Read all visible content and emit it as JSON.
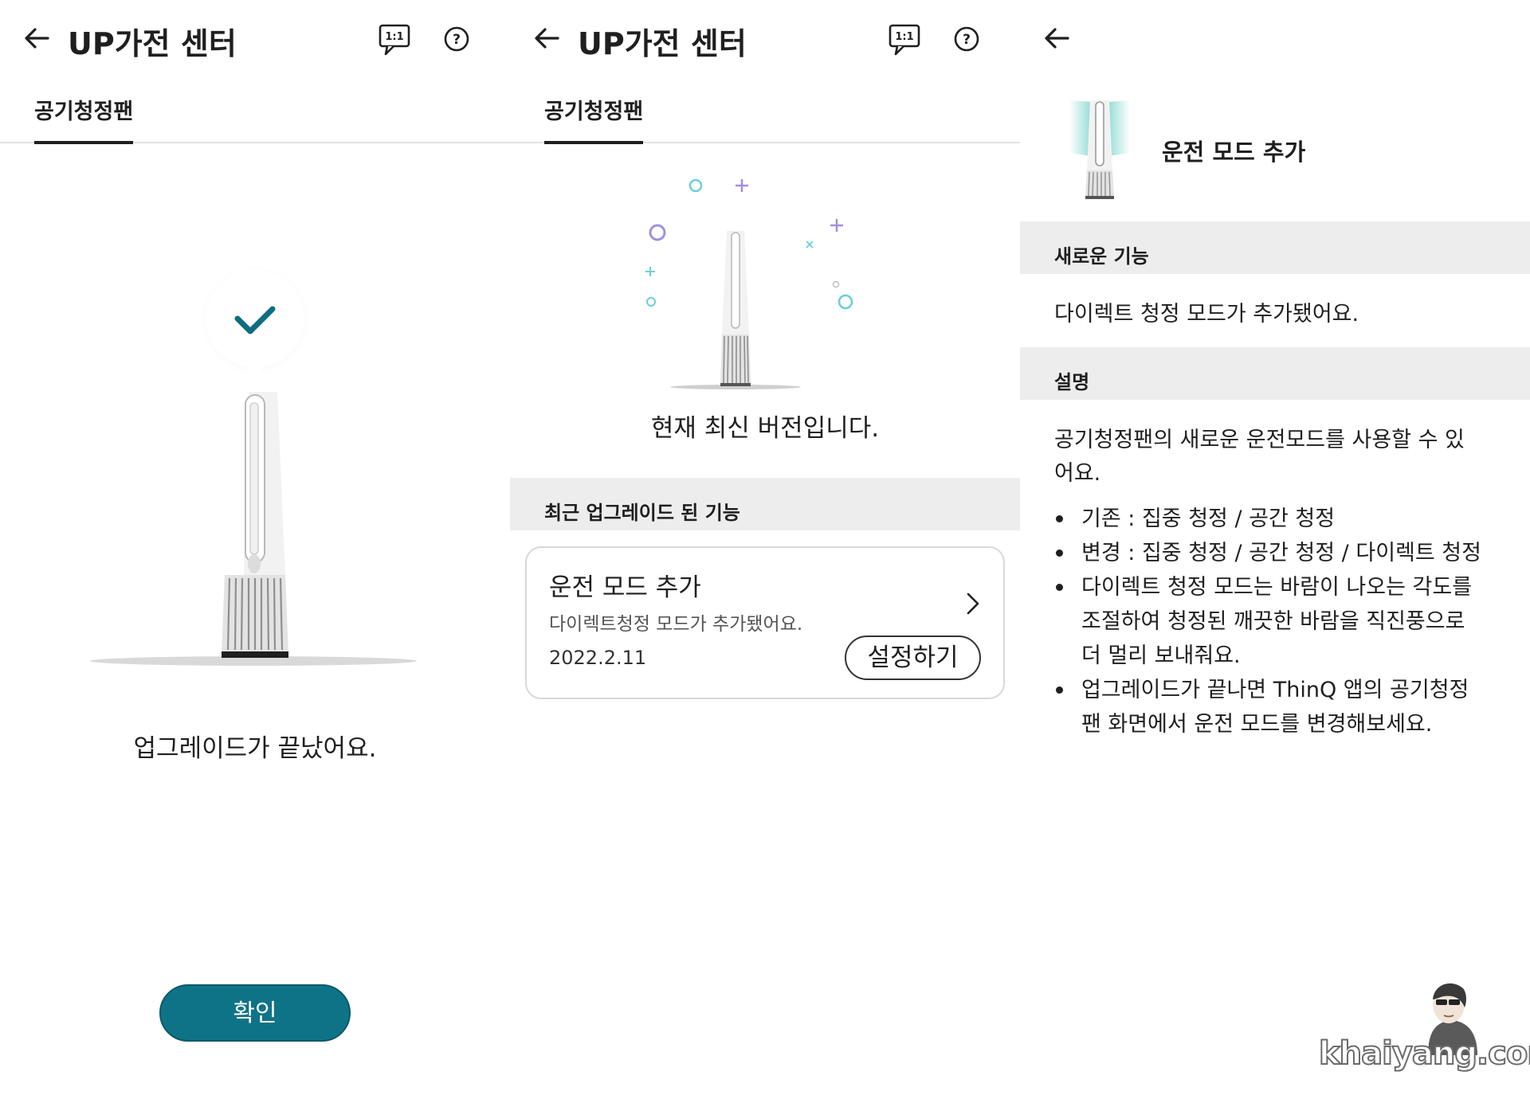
{
  "panel1": {
    "header": {
      "title": "UP가전 센터"
    },
    "tab": {
      "label": "공기청정팬"
    },
    "status_text": "업그레이드가 끝났어요.",
    "confirm_label": "확인"
  },
  "panel2": {
    "header": {
      "title": "UP가전 센터"
    },
    "tab": {
      "label": "공기청정팬"
    },
    "status_text": "현재 최신 버전입니다.",
    "section_title": "최근 업그레이드 된 기능",
    "card": {
      "title": "운전 모드 추가",
      "description": "다이렉트청정 모드가 추가됐어요.",
      "date": "2022.2.11",
      "button_label": "설정하기"
    }
  },
  "panel3": {
    "mode_title": "운전 모드 추가",
    "new_feature_header": "새로운 기능",
    "new_feature_text": "다이렉트 청정 모드가 추가됐어요.",
    "description_header": "설명",
    "description_lines": [
      "공기청정팬의 새로운 운전모드를 사용할 수 있",
      "어요."
    ],
    "bullets": [
      "기존 : 집중 청정 / 공간 청정",
      "변경 : 집중 청정 / 공간 청정 / 다이렉트 청정",
      "다이렉트 청정 모드는 바람이 나오는 각도를 조절하여 청정된 깨끗한 바람을 직진풍으로 더 멀리 보내줘요.",
      "업그레이드가 끝나면 ThinQ 앱의 공기청정팬 화면에서 운전 모드를 변경해보세요."
    ]
  },
  "icons": {
    "back": "arrow-left-icon",
    "chat": "one-to-one-chat-icon",
    "help": "question-circle-icon",
    "chevron": "chevron-right-icon",
    "check": "checkmark-icon"
  },
  "colors": {
    "accent": "#0f7387",
    "section_bg": "#ededed",
    "mint": "#7fd6cc",
    "sparkle_purple": "#a18fe0",
    "sparkle_teal": "#6ad0d9"
  },
  "watermark": {
    "text": "khaiyang.com"
  }
}
